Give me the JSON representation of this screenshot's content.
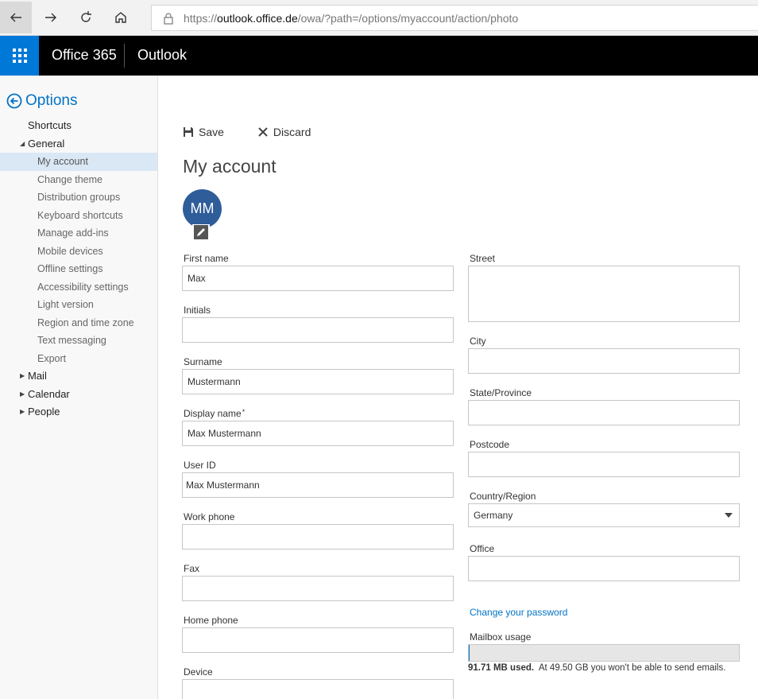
{
  "browser": {
    "url_protocol": "https://",
    "url_host": "outlook.office.de",
    "url_path": "/owa/?path=/options/myaccount/action/photo"
  },
  "suite": {
    "brand": "Office 365",
    "app": "Outlook",
    "accent_color": "#0078d7"
  },
  "sidebar": {
    "title": "Options",
    "items": [
      {
        "label": "Shortcuts",
        "level": "top",
        "expander": ""
      },
      {
        "label": "General",
        "level": "top",
        "expander": "expanded"
      },
      {
        "label": "My account",
        "level": "sub",
        "active": true
      },
      {
        "label": "Change theme",
        "level": "sub"
      },
      {
        "label": "Distribution groups",
        "level": "sub"
      },
      {
        "label": "Keyboard shortcuts",
        "level": "sub"
      },
      {
        "label": "Manage add-ins",
        "level": "sub"
      },
      {
        "label": "Mobile devices",
        "level": "sub"
      },
      {
        "label": "Offline settings",
        "level": "sub"
      },
      {
        "label": "Accessibility settings",
        "level": "sub"
      },
      {
        "label": "Light version",
        "level": "sub"
      },
      {
        "label": "Region and time zone",
        "level": "sub"
      },
      {
        "label": "Text messaging",
        "level": "sub"
      },
      {
        "label": "Export",
        "level": "sub"
      },
      {
        "label": "Mail",
        "level": "top",
        "expander": "collapsed"
      },
      {
        "label": "Calendar",
        "level": "top",
        "expander": "collapsed"
      },
      {
        "label": "People",
        "level": "top",
        "expander": "collapsed"
      }
    ]
  },
  "toolbar": {
    "save_label": "Save",
    "discard_label": "Discard"
  },
  "page": {
    "title": "My account",
    "avatar_initials": "MM"
  },
  "form_left": {
    "first_name": {
      "label": "First name",
      "value": "Max"
    },
    "initials": {
      "label": "Initials",
      "value": ""
    },
    "surname": {
      "label": "Surname",
      "value": "Mustermann"
    },
    "display_name": {
      "label": "Display name",
      "required_mark": "*",
      "value": "Max Mustermann"
    },
    "user_id": {
      "label": "User ID",
      "value": "Max Mustermann"
    },
    "work_phone": {
      "label": "Work phone",
      "value": ""
    },
    "fax": {
      "label": "Fax",
      "value": ""
    },
    "home_phone": {
      "label": "Home phone",
      "value": ""
    },
    "device": {
      "label": "Device",
      "value": ""
    }
  },
  "form_right": {
    "street": {
      "label": "Street",
      "value": ""
    },
    "city": {
      "label": "City",
      "value": ""
    },
    "state": {
      "label": "State/Province",
      "value": ""
    },
    "postcode": {
      "label": "Postcode",
      "value": ""
    },
    "country": {
      "label": "Country/Region",
      "value": "Germany"
    },
    "office": {
      "label": "Office",
      "value": ""
    }
  },
  "account": {
    "change_password_link": "Change your password",
    "mailbox_usage_label": "Mailbox usage",
    "usage_used": "91.71 MB used.",
    "usage_note": "At 49.50 GB you won't be able to send emails.",
    "usage_fraction": 0.0018
  }
}
